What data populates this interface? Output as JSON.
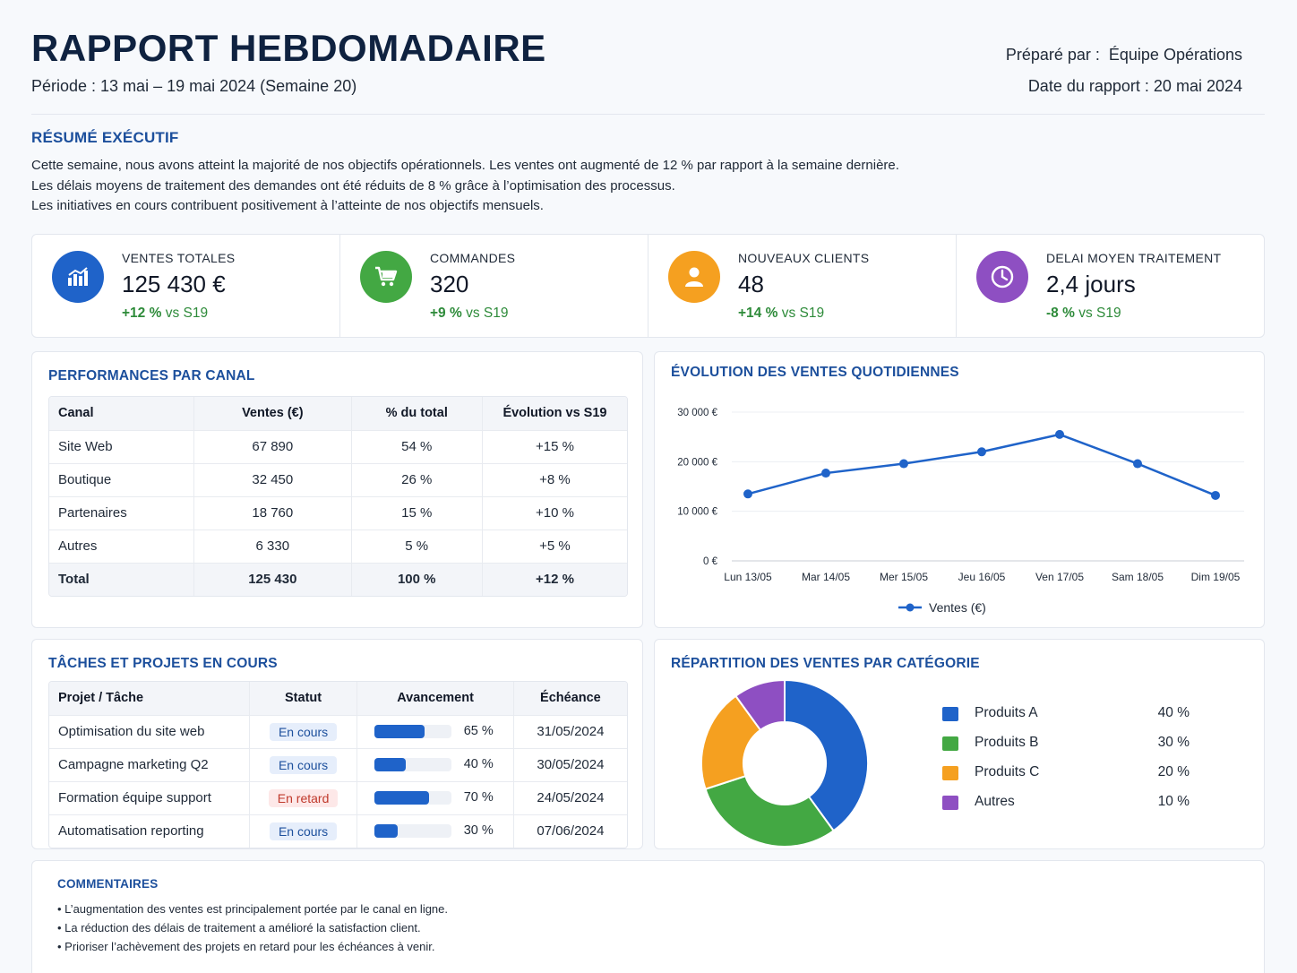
{
  "header": {
    "title": "RAPPORT HEBDOMADAIRE",
    "period": "Période : 13 mai – 19 mai 2024 (Semaine 20)",
    "prepared_label": "Préparé par :",
    "prepared_value": "Équipe Opérations",
    "date_label": "Date du rapport :",
    "date_value": "20 mai 2024"
  },
  "summary": {
    "title": "RÉSUMÉ EXÉCUTIF",
    "lines": [
      "Cette semaine, nous avons atteint la majorité de nos objectifs opérationnels. Les ventes ont augmenté de 12 % par rapport à la semaine dernière.",
      "Les délais moyens de traitement des demandes ont été réduits de 8 % grâce à l’optimisation des processus.",
      "Les initiatives en cours contribuent positivement à l’atteinte de nos objectifs mensuels."
    ]
  },
  "kpis": [
    {
      "label": "VENTES TOTALES",
      "value": "125 430 €",
      "delta": "+12 %",
      "vs": "vs S19",
      "icon": "bar-chart-icon",
      "color": "#1f63c9"
    },
    {
      "label": "COMMANDES",
      "value": "320",
      "delta": "+9 %",
      "vs": "vs S19",
      "icon": "cart-icon",
      "color": "#43a843"
    },
    {
      "label": "NOUVEAUX CLIENTS",
      "value": "48",
      "delta": "+14 %",
      "vs": "vs S19",
      "icon": "user-icon",
      "color": "#f5a020"
    },
    {
      "label": "DELAI MOYEN TRAITEMENT",
      "value": "2,4 jours",
      "delta": "-8 %",
      "vs": "vs S19",
      "icon": "clock-icon",
      "color": "#8e4fc2"
    }
  ],
  "channels": {
    "title": "PERFORMANCES PAR CANAL",
    "headers": [
      "Canal",
      "Ventes (€)",
      "% du total",
      "Évolution vs S19"
    ],
    "rows": [
      [
        "Site Web",
        "67 890",
        "54 %",
        "+15 %"
      ],
      [
        "Boutique",
        "32 450",
        "26 %",
        "+8 %"
      ],
      [
        "Partenaires",
        "18 760",
        "15 %",
        "+10 %"
      ],
      [
        "Autres",
        "6 330",
        "5 %",
        "+5 %"
      ]
    ],
    "total": [
      "Total",
      "125 430",
      "100 %",
      "+12 %"
    ]
  },
  "line_chart": {
    "title": "ÉVOLUTION DES VENTES QUOTIDIENNES",
    "y_ticks": [
      "30 000 €",
      "20 000 €",
      "10 000 €",
      "0 €"
    ],
    "legend": "Ventes (€)"
  },
  "tasks": {
    "title": "TÂCHES ET PROJETS EN COURS",
    "headers": [
      "Projet / Tâche",
      "Statut",
      "Avancement",
      "Échéance"
    ],
    "rows": [
      {
        "name": "Optimisation du site web",
        "status": "En cours",
        "status_color": "blue",
        "progress": 65,
        "progress_label": "65 %",
        "due": "31/05/2024"
      },
      {
        "name": "Campagne marketing Q2",
        "status": "En cours",
        "status_color": "blue",
        "progress": 40,
        "progress_label": "40 %",
        "due": "30/05/2024"
      },
      {
        "name": "Formation équipe support",
        "status": "En retard",
        "status_color": "red",
        "progress": 70,
        "progress_label": "70 %",
        "due": "24/05/2024"
      },
      {
        "name": "Automatisation reporting",
        "status": "En cours",
        "status_color": "blue",
        "progress": 30,
        "progress_label": "30 %",
        "due": "07/06/2024"
      }
    ]
  },
  "donut": {
    "title": "RÉPARTITION DES VENTES PAR CATÉGORIE"
  },
  "comments": {
    "title": "COMMENTAIRES",
    "items": [
      "L’augmentation des ventes est principalement portée par le canal en ligne.",
      "La réduction des délais de traitement a amélioré la satisfaction client.",
      "Prioriser l’achèvement des projets en retard pour les échéances à venir."
    ]
  },
  "chart_data": [
    {
      "type": "line",
      "title": "ÉVOLUTION DES VENTES QUOTIDIENNES",
      "categories": [
        "Lun 13/05",
        "Mar 14/05",
        "Mer 15/05",
        "Jeu 16/05",
        "Ven 17/05",
        "Sam 18/05",
        "Dim 19/05"
      ],
      "series": [
        {
          "name": "Ventes (€)",
          "values": [
            13500,
            17700,
            19600,
            22000,
            25500,
            19600,
            13200
          ],
          "color": "#1f63c9"
        }
      ],
      "ylim": [
        0,
        30000
      ],
      "y_ticks": [
        0,
        10000,
        20000,
        30000
      ],
      "grid": true,
      "legend": "bottom"
    },
    {
      "type": "pie",
      "title": "RÉPARTITION DES VENTES PAR CATÉGORIE",
      "labels": [
        "Produits A",
        "Produits B",
        "Produits C",
        "Autres"
      ],
      "values": [
        40,
        30,
        20,
        10
      ],
      "value_labels": [
        "40 %",
        "30 %",
        "20 %",
        "10 %"
      ],
      "colors": [
        "#1f63c9",
        "#43a843",
        "#f5a020",
        "#8e4fc2"
      ],
      "legend": "right"
    }
  ]
}
